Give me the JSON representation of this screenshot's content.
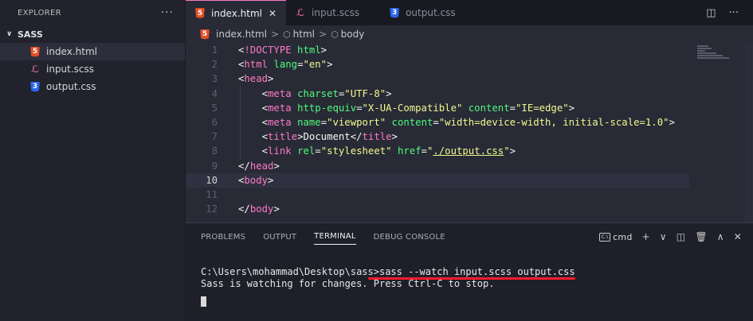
{
  "sidebar": {
    "title": "EXPLORER",
    "more": "···",
    "folder": "SASS",
    "files": [
      {
        "name": "index.html",
        "type": "html"
      },
      {
        "name": "input.scss",
        "type": "scss"
      },
      {
        "name": "output.css",
        "type": "css"
      }
    ]
  },
  "tabs": [
    {
      "label": "index.html",
      "type": "html",
      "active": true
    },
    {
      "label": "input.scss",
      "type": "scss",
      "active": false
    },
    {
      "label": "output.css",
      "type": "css",
      "active": false
    }
  ],
  "breadcrumb": [
    "index.html",
    "html",
    "body"
  ],
  "editor": {
    "current_line": 10,
    "lines": [
      {
        "n": "1",
        "tokens": [
          [
            "t-pun",
            "<"
          ],
          [
            "t-tag",
            "!DOCTYPE"
          ],
          [
            "t-txt",
            " "
          ],
          [
            "t-attr",
            "html"
          ],
          [
            "t-pun",
            ">"
          ]
        ]
      },
      {
        "n": "2",
        "tokens": [
          [
            "t-pun",
            "<"
          ],
          [
            "t-tag",
            "html"
          ],
          [
            "t-txt",
            " "
          ],
          [
            "t-attr",
            "lang"
          ],
          [
            "t-pun",
            "="
          ],
          [
            "t-str",
            "\"en\""
          ],
          [
            "t-pun",
            ">"
          ]
        ]
      },
      {
        "n": "3",
        "tokens": [
          [
            "t-pun",
            "<"
          ],
          [
            "t-tag",
            "head"
          ],
          [
            "t-pun",
            ">"
          ]
        ]
      },
      {
        "n": "4",
        "tokens": [
          [
            "t-txt",
            "    "
          ],
          [
            "t-pun",
            "<"
          ],
          [
            "t-tag",
            "meta"
          ],
          [
            "t-txt",
            " "
          ],
          [
            "t-attr",
            "charset"
          ],
          [
            "t-pun",
            "="
          ],
          [
            "t-str",
            "\"UTF-8\""
          ],
          [
            "t-pun",
            ">"
          ]
        ]
      },
      {
        "n": "5",
        "tokens": [
          [
            "t-txt",
            "    "
          ],
          [
            "t-pun",
            "<"
          ],
          [
            "t-tag",
            "meta"
          ],
          [
            "t-txt",
            " "
          ],
          [
            "t-attr",
            "http-equiv"
          ],
          [
            "t-pun",
            "="
          ],
          [
            "t-str",
            "\"X-UA-Compatible\""
          ],
          [
            "t-txt",
            " "
          ],
          [
            "t-attr",
            "content"
          ],
          [
            "t-pun",
            "="
          ],
          [
            "t-str",
            "\"IE=edge\""
          ],
          [
            "t-pun",
            ">"
          ]
        ]
      },
      {
        "n": "6",
        "tokens": [
          [
            "t-txt",
            "    "
          ],
          [
            "t-pun",
            "<"
          ],
          [
            "t-tag",
            "meta"
          ],
          [
            "t-txt",
            " "
          ],
          [
            "t-attr",
            "name"
          ],
          [
            "t-pun",
            "="
          ],
          [
            "t-str",
            "\"viewport\""
          ],
          [
            "t-txt",
            " "
          ],
          [
            "t-attr",
            "content"
          ],
          [
            "t-pun",
            "="
          ],
          [
            "t-str",
            "\"width=device-width, initial-scale=1.0\""
          ],
          [
            "t-pun",
            ">"
          ]
        ]
      },
      {
        "n": "7",
        "tokens": [
          [
            "t-txt",
            "    "
          ],
          [
            "t-pun",
            "<"
          ],
          [
            "t-tag",
            "title"
          ],
          [
            "t-pun",
            ">"
          ],
          [
            "t-txt",
            "Document"
          ],
          [
            "t-pun",
            "</"
          ],
          [
            "t-tag",
            "title"
          ],
          [
            "t-pun",
            ">"
          ]
        ]
      },
      {
        "n": "8",
        "tokens": [
          [
            "t-txt",
            "    "
          ],
          [
            "t-pun",
            "<"
          ],
          [
            "t-tag",
            "link"
          ],
          [
            "t-txt",
            " "
          ],
          [
            "t-attr",
            "rel"
          ],
          [
            "t-pun",
            "="
          ],
          [
            "t-str",
            "\"stylesheet\""
          ],
          [
            "t-txt",
            " "
          ],
          [
            "t-attr",
            "href"
          ],
          [
            "t-pun",
            "="
          ],
          [
            "t-str",
            "\""
          ],
          [
            "t-str t-link",
            "./output.css"
          ],
          [
            "t-str",
            "\""
          ],
          [
            "t-pun",
            ">"
          ]
        ]
      },
      {
        "n": "9",
        "tokens": [
          [
            "t-pun",
            "</"
          ],
          [
            "t-tag",
            "head"
          ],
          [
            "t-pun",
            ">"
          ]
        ]
      },
      {
        "n": "10",
        "tokens": [
          [
            "t-pun",
            "<"
          ],
          [
            "t-tag",
            "body"
          ],
          [
            "t-pun",
            ">"
          ]
        ]
      },
      {
        "n": "11",
        "tokens": []
      },
      {
        "n": "12",
        "tokens": [
          [
            "t-pun",
            "</"
          ],
          [
            "t-tag",
            "body"
          ],
          [
            "t-pun",
            ">"
          ]
        ]
      }
    ]
  },
  "panel": {
    "tabs": [
      "PROBLEMS",
      "OUTPUT",
      "TERMINAL",
      "DEBUG CONSOLE"
    ],
    "active_tab": "TERMINAL",
    "shell": "cmd",
    "terminal": {
      "prompt": "C:\\Users\\mohammad\\Desktop\\sass>",
      "command": "sass --watch input.scss output.css",
      "output": "Sass is watching for changes. Press Ctrl-C to stop."
    }
  }
}
